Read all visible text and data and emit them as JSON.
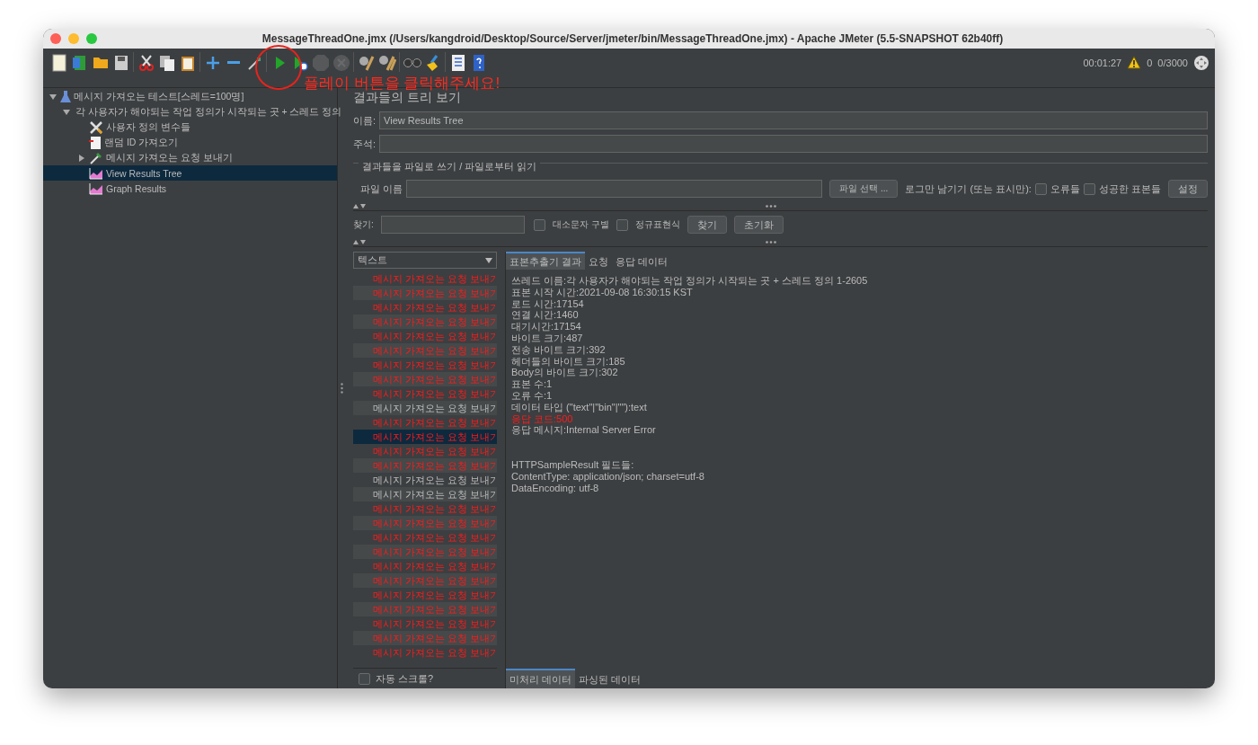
{
  "window": {
    "title": "MessageThreadOne.jmx (/Users/kangdroid/Desktop/Source/Server/jmeter/bin/MessageThreadOne.jmx) - Apache JMeter (5.5-SNAPSHOT 62b40ff)"
  },
  "toolbar": {
    "buttons": [
      {
        "disabled": false
      },
      {
        "disabled": false
      },
      {
        "disabled": false
      },
      {
        "disabled": false
      },
      {
        "disabled": false
      },
      {
        "disabled": false
      },
      {
        "disabled": false
      },
      {
        "disabled": false
      },
      {
        "disabled": false
      },
      {
        "disabled": false
      },
      {
        "disabled": false
      },
      {
        "disabled": false
      },
      {
        "disabled": true
      },
      {
        "disabled": true
      },
      {
        "disabled": false
      },
      {
        "disabled": false
      },
      {
        "disabled": false
      },
      {
        "disabled": false
      },
      {
        "disabled": false
      },
      {
        "disabled": false
      }
    ],
    "elapsed": "00:01:27",
    "warnings": "0",
    "threads": "0/3000"
  },
  "annotation": {
    "text": "플레이 버튼을 클릭해주세요!"
  },
  "tree": [
    {
      "label": "메시지 가져오는 테스트[스레드=100명]",
      "kind": "plan",
      "expanded": true,
      "selected": false,
      "children": [
        {
          "label": "각 사용자가 해야되는 작업 정의가 시작되는 곳 + 스레드 정의",
          "kind": "group",
          "expanded": true,
          "selected": false,
          "children": [
            {
              "label": "사용자 정의 변수들",
              "kind": "vars",
              "selected": false
            },
            {
              "label": "랜덤 ID 가져오기",
              "kind": "script",
              "selected": false
            },
            {
              "label": "메시지 가져오는 요청 보내기",
              "kind": "sampler",
              "expanded": false,
              "selected": false
            },
            {
              "label": "View Results Tree",
              "kind": "listener",
              "selected": true
            },
            {
              "label": "Graph Results",
              "kind": "listener",
              "selected": false
            }
          ]
        }
      ]
    }
  ],
  "panel": {
    "title": "결과들의 트리 보기",
    "name_label": "이름:",
    "name_value": "View Results Tree",
    "comment_label": "주석:",
    "file_group": "결과들을 파일로 쓰기 / 파일로부터 읽기",
    "file_label": "파일 이름",
    "browse_button": "파일 선택 ...",
    "log_only_label": "로그만 남기기 (또는 표시만):",
    "errors": {
      "label": "오류들",
      "checked": false
    },
    "successes": {
      "label": "성공한 표본들",
      "checked": false
    },
    "configure_button": "설정",
    "search_label": "찾기:",
    "case_sensitive": {
      "label": "대소문자 구별",
      "checked": false
    },
    "regex": {
      "label": "정규표현식",
      "checked": false
    },
    "find_button": "찾기",
    "reset_button": "초기화",
    "renderer": "텍스트",
    "autoscroll": {
      "label": "자동 스크롤?",
      "checked": false
    }
  },
  "results": [
    {
      "label": "메시지 가져오는 요청 보내기",
      "success": false,
      "selected": false
    },
    {
      "label": "메시지 가져오는 요청 보내기",
      "success": false,
      "selected": false
    },
    {
      "label": "메시지 가져오는 요청 보내기",
      "success": false,
      "selected": false
    },
    {
      "label": "메시지 가져오는 요청 보내기",
      "success": false,
      "selected": false
    },
    {
      "label": "메시지 가져오는 요청 보내기",
      "success": false,
      "selected": false
    },
    {
      "label": "메시지 가져오는 요청 보내기",
      "success": false,
      "selected": false
    },
    {
      "label": "메시지 가져오는 요청 보내기",
      "success": false,
      "selected": false
    },
    {
      "label": "메시지 가져오는 요청 보내기",
      "success": false,
      "selected": false
    },
    {
      "label": "메시지 가져오는 요청 보내기",
      "success": false,
      "selected": false
    },
    {
      "label": "메시지 가져오는 요청 보내기",
      "success": true,
      "selected": false
    },
    {
      "label": "메시지 가져오는 요청 보내기",
      "success": false,
      "selected": false
    },
    {
      "label": "메시지 가져오는 요청 보내기",
      "success": false,
      "selected": true
    },
    {
      "label": "메시지 가져오는 요청 보내기",
      "success": false,
      "selected": false
    },
    {
      "label": "메시지 가져오는 요청 보내기",
      "success": false,
      "selected": false
    },
    {
      "label": "메시지 가져오는 요청 보내기",
      "success": true,
      "selected": false
    },
    {
      "label": "메시지 가져오는 요청 보내기",
      "success": true,
      "selected": false
    },
    {
      "label": "메시지 가져오는 요청 보내기",
      "success": false,
      "selected": false
    },
    {
      "label": "메시지 가져오는 요청 보내기",
      "success": false,
      "selected": false
    },
    {
      "label": "메시지 가져오는 요청 보내기",
      "success": false,
      "selected": false
    },
    {
      "label": "메시지 가져오는 요청 보내기",
      "success": false,
      "selected": false
    },
    {
      "label": "메시지 가져오는 요청 보내기",
      "success": false,
      "selected": false
    },
    {
      "label": "메시지 가져오는 요청 보내기",
      "success": false,
      "selected": false
    },
    {
      "label": "메시지 가져오는 요청 보내기",
      "success": false,
      "selected": false
    },
    {
      "label": "메시지 가져오는 요청 보내기",
      "success": false,
      "selected": false
    },
    {
      "label": "메시지 가져오는 요청 보내기",
      "success": false,
      "selected": false
    },
    {
      "label": "메시지 가져오는 요청 보내기",
      "success": false,
      "selected": false
    },
    {
      "label": "메시지 가져오는 요청 보내기",
      "success": false,
      "selected": false
    }
  ],
  "detail_tabs": [
    {
      "label": "표본추출기 결과",
      "selected": true
    },
    {
      "label": "요청",
      "selected": false
    },
    {
      "label": "응답 데이터",
      "selected": false
    }
  ],
  "detail_sections": [
    [
      {
        "text": "쓰레드 이름:각 사용자가 해야되는 작업 정의가 시작되는 곳 + 스레드 정의 1-2605",
        "error": false
      },
      {
        "text": "표본 시작 시간:2021-09-08 16:30:15 KST",
        "error": false
      },
      {
        "text": "로드 시간:17154",
        "error": false
      },
      {
        "text": "연결 시간:1460",
        "error": false
      },
      {
        "text": "대기시간:17154",
        "error": false
      },
      {
        "text": "바이트 크기:487",
        "error": false
      },
      {
        "text": "전송 바이트 크기:392",
        "error": false
      },
      {
        "text": "헤더들의 바이트 크기:185",
        "error": false
      },
      {
        "text": "Body의 바이트 크기:302",
        "error": false
      },
      {
        "text": "표본 수:1",
        "error": false
      },
      {
        "text": "오류 수:1",
        "error": false
      },
      {
        "text": "데이터 타입 (\"text\"|\"bin\"|\"\"):text",
        "error": false
      },
      {
        "text": "응답 코드:500",
        "error": true
      },
      {
        "text": "응답 메시지:Internal Server Error",
        "error": false
      }
    ],
    [
      {
        "text": "HTTPSampleResult 필드들:",
        "error": false
      },
      {
        "text": "ContentType: application/json; charset=utf-8",
        "error": false
      },
      {
        "text": "DataEncoding: utf-8",
        "error": false
      }
    ]
  ],
  "data_tabs": [
    {
      "label": "미처리 데이터",
      "selected": true
    },
    {
      "label": "파싱된 데이터",
      "selected": false
    }
  ]
}
